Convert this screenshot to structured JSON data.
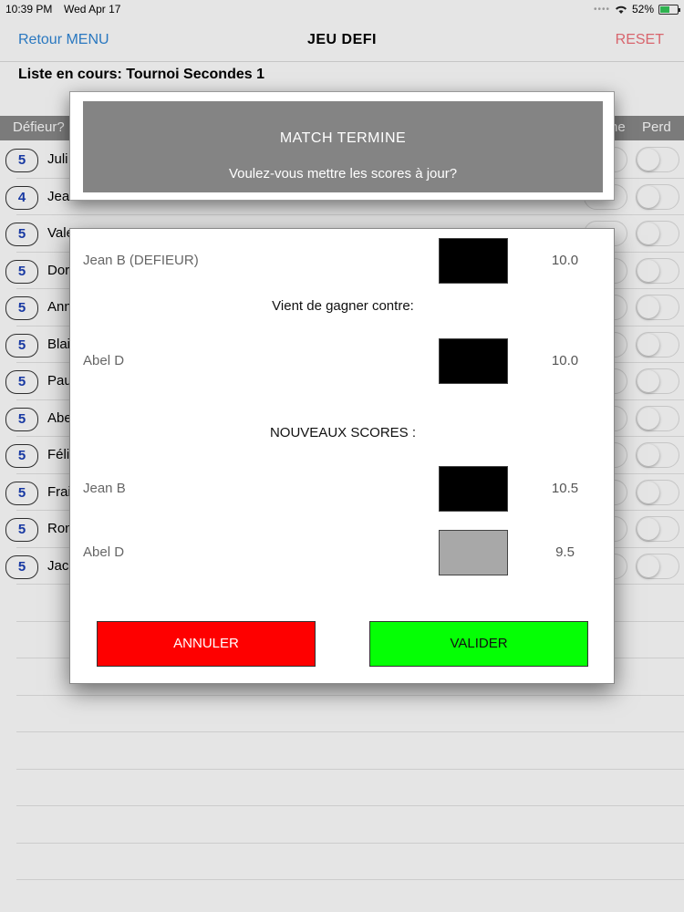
{
  "status_bar": {
    "time": "10:39 PM",
    "date": "Wed Apr 17",
    "battery": "52%"
  },
  "nav": {
    "back_label": "Retour MENU",
    "title": "JEU  DEFI",
    "reset_label": "RESET"
  },
  "list_header": "Liste en cours: Tournoi Secondes 1",
  "table": {
    "col_challenger": "Défieur?",
    "col_win_partial": "ne",
    "col_lose": "Perd",
    "rows": [
      {
        "badge": "5",
        "name": "Juli"
      },
      {
        "badge": "4",
        "name": "Jea"
      },
      {
        "badge": "5",
        "name": "Vale"
      },
      {
        "badge": "5",
        "name": "Dor"
      },
      {
        "badge": "5",
        "name": "Ann"
      },
      {
        "badge": "5",
        "name": "Blai"
      },
      {
        "badge": "5",
        "name": "Pau"
      },
      {
        "badge": "5",
        "name": "Abe"
      },
      {
        "badge": "5",
        "name": "Féli"
      },
      {
        "badge": "5",
        "name": "Frai"
      },
      {
        "badge": "5",
        "name": "Ron"
      },
      {
        "badge": "5",
        "name": "Jac"
      }
    ]
  },
  "alert": {
    "title": "MATCH  TERMINE",
    "message": "Voulez-vous mettre les scores à jour?"
  },
  "dialog": {
    "winner_label": "Jean B (DEFIEUR)",
    "winner_score": "10.0",
    "winner_color": "#000000",
    "vs_text": "Vient de gagner contre:",
    "loser_label": "Abel D",
    "loser_score": "10.0",
    "loser_color": "#000000",
    "new_scores_title": "NOUVEAUX SCORES :",
    "new_winner_label": "Jean B",
    "new_winner_score": "10.5",
    "new_winner_color": "#000000",
    "new_loser_label": "Abel D",
    "new_loser_score": "9.5",
    "new_loser_color": "#a8a8a8",
    "cancel_label": "ANNULER",
    "cancel_color": "#fe0000",
    "validate_label": "VALIDER",
    "validate_color": "#05ff05"
  }
}
